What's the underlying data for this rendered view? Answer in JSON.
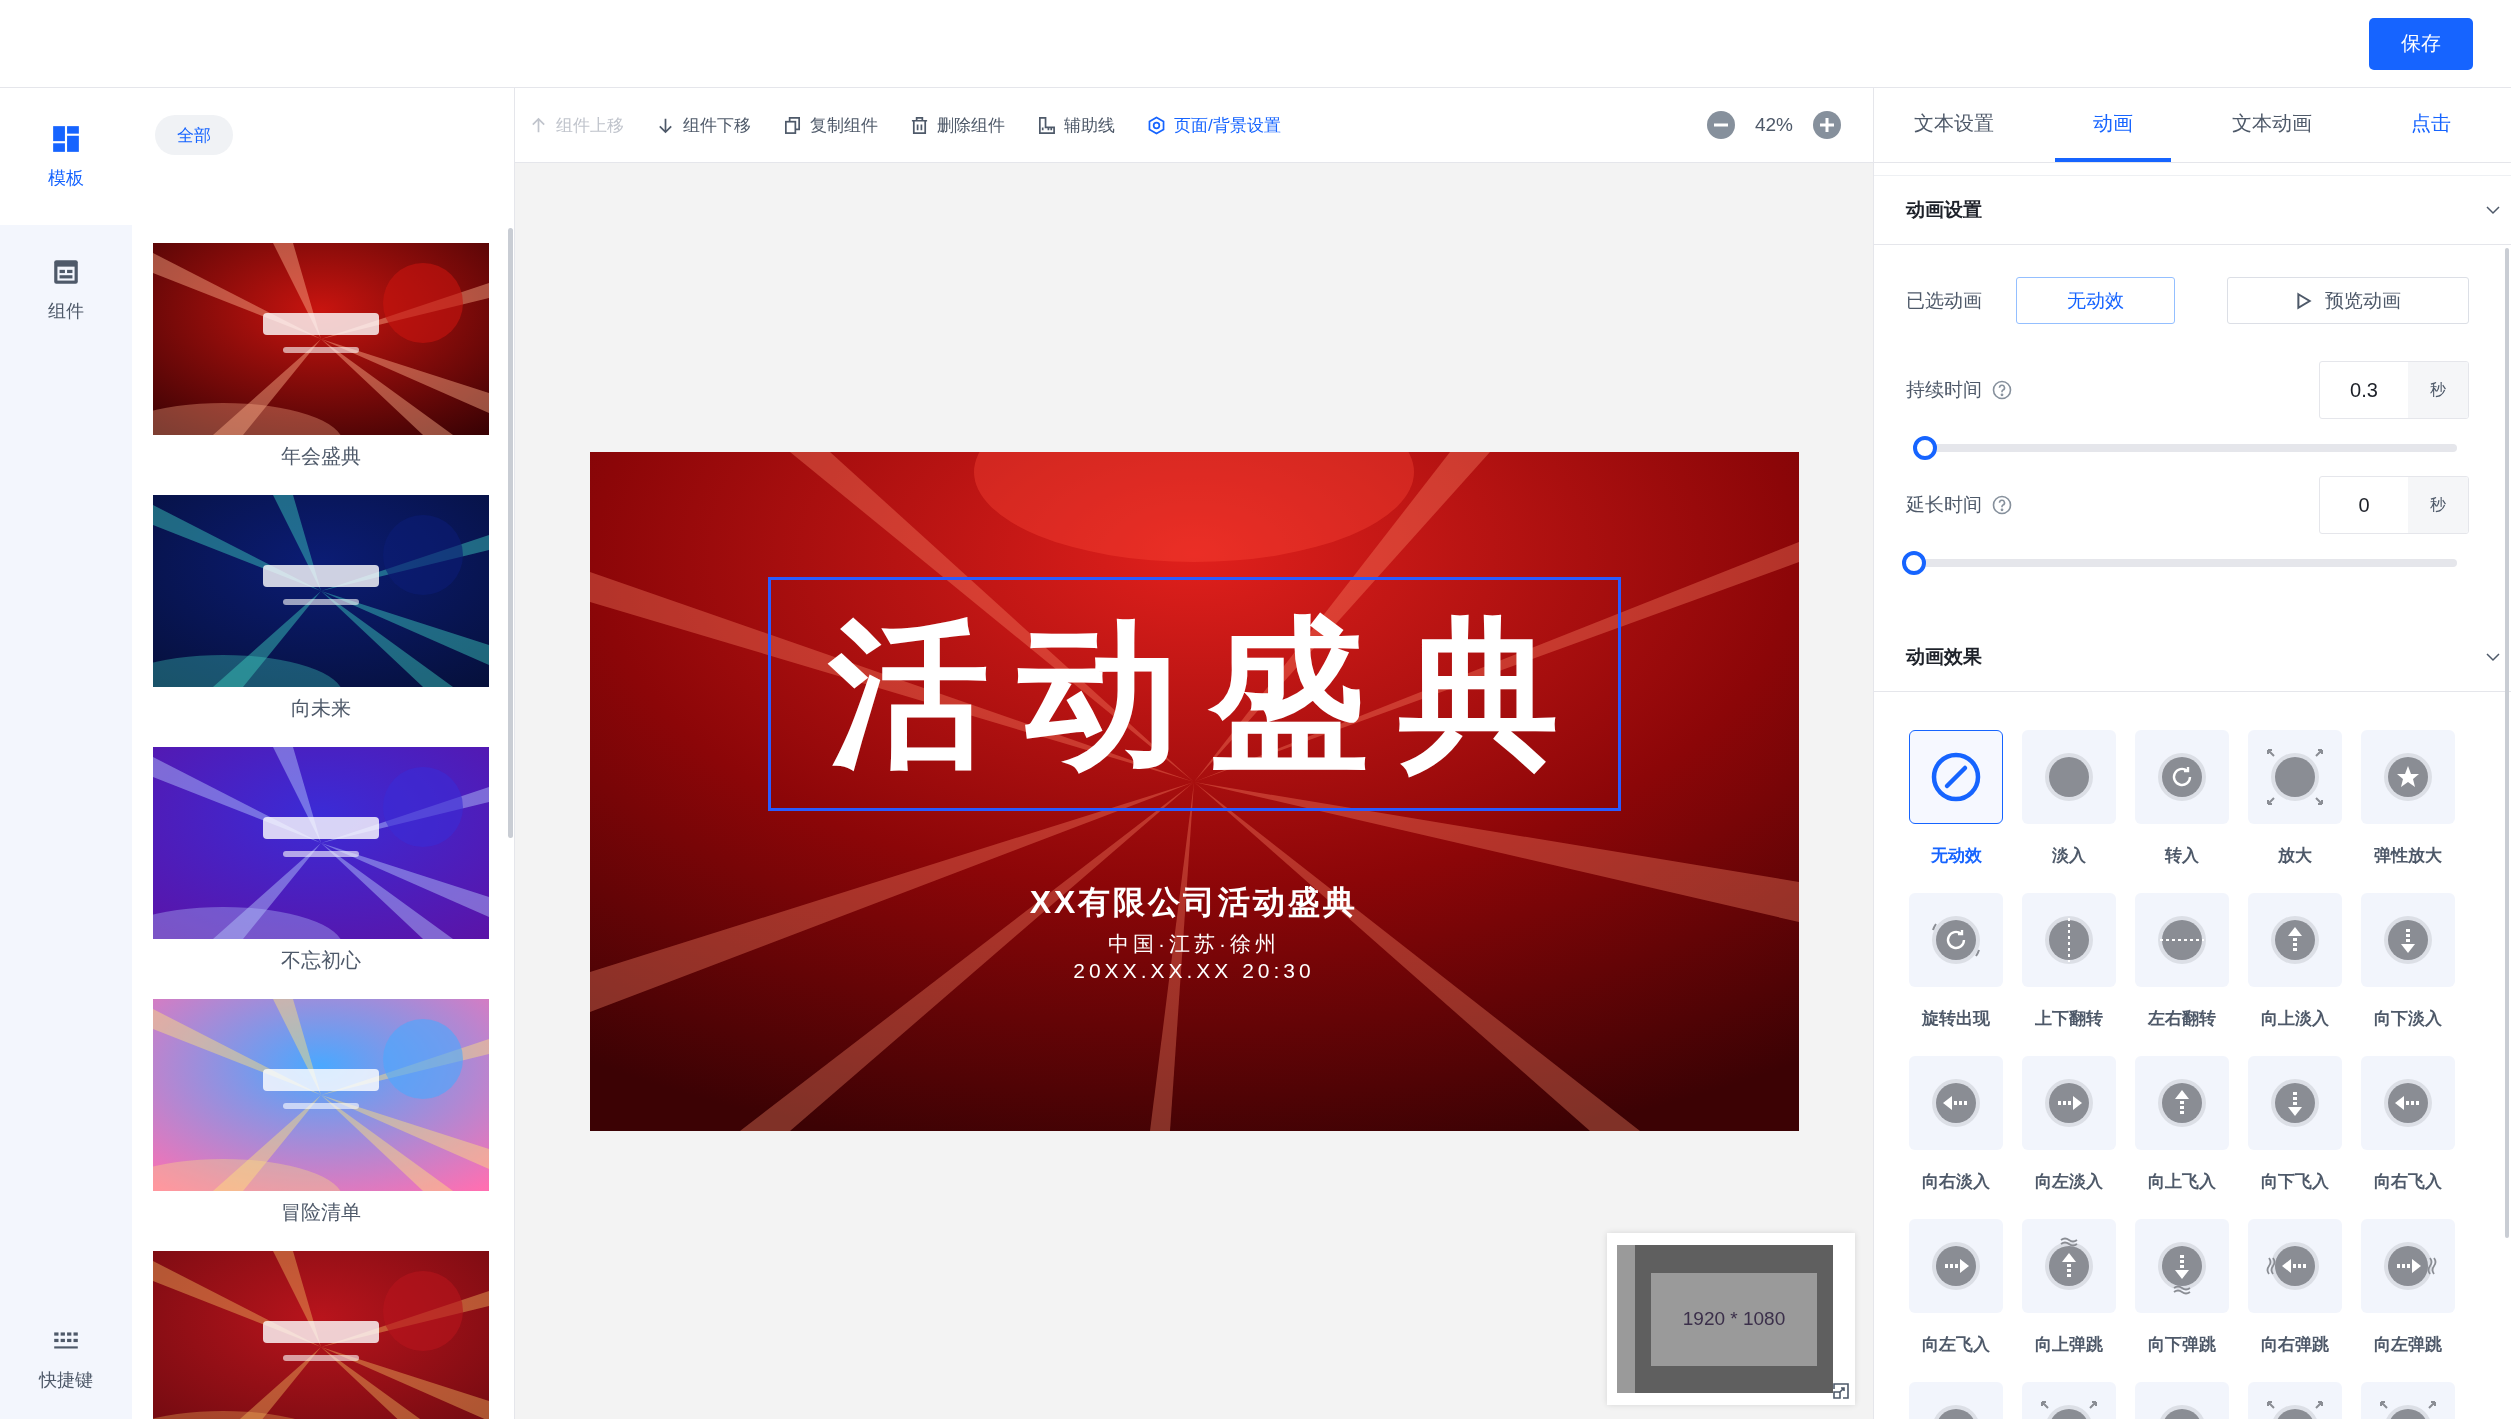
{
  "header": {
    "save_button": "保存"
  },
  "rail": {
    "items": [
      {
        "label": "模板",
        "kind": "template",
        "selected": true
      },
      {
        "label": "组件",
        "kind": "component",
        "selected": false
      }
    ],
    "shortcut": {
      "label": "快捷键"
    }
  },
  "templates": {
    "filter": {
      "label": "全部",
      "selected": true
    },
    "items": [
      {
        "kind": "picture",
        "caption": "年会盛典"
      },
      {
        "kind": "picture",
        "caption": "向未来"
      },
      {
        "kind": "picture",
        "caption": "不忘初心"
      },
      {
        "kind": "picture",
        "caption": "冒险清单"
      },
      {
        "kind": "picture"
      }
    ]
  },
  "toolbar": {
    "items": [
      {
        "label": "组件上移",
        "kind": "up",
        "disabled": true,
        "selected": false
      },
      {
        "label": "组件下移",
        "kind": "down",
        "disabled": false,
        "selected": false
      },
      {
        "label": "复制组件",
        "kind": "copy",
        "disabled": false,
        "selected": false
      },
      {
        "label": "删除组件",
        "kind": "trash",
        "disabled": false,
        "selected": false
      },
      {
        "label": "辅助线",
        "kind": "ruler",
        "disabled": false,
        "selected": false
      },
      {
        "label": "页面/背景设置",
        "kind": "gear",
        "disabled": false,
        "selected": true
      }
    ],
    "zoom": "42%"
  },
  "canvas": {
    "slide": {
      "title": "活动盛典",
      "title_selected": true,
      "subtitle": "XX有限公司活动盛典",
      "location": "中国·江苏·徐州",
      "datetime": "20XX.XX.XX 20:30"
    },
    "minimap": {
      "size": "1920 * 1080"
    }
  },
  "panel": {
    "tabs": [
      {
        "label": "文本设置",
        "selected": false,
        "highlighted": false
      },
      {
        "label": "动画",
        "selected": true,
        "highlighted": false
      },
      {
        "label": "文本动画",
        "selected": false,
        "highlighted": false
      },
      {
        "label": "点击",
        "selected": false,
        "highlighted": true
      }
    ],
    "animation_settings": {
      "title": "动画设置",
      "expanded": true,
      "selected_label": "已选动画",
      "selected_value": "无动效",
      "preview_button": "预览动画",
      "duration": {
        "label": "持续时间",
        "value": "0.3",
        "unit": "秒",
        "level": 0.02
      },
      "delay": {
        "label": "延长时间",
        "value": "0",
        "unit": "秒",
        "level": 0
      }
    },
    "effects": {
      "title": "动画效果",
      "expanded": true,
      "items": [
        {
          "label": "无动效",
          "kind": "none",
          "selected": true
        },
        {
          "label": "淡入",
          "kind": "circle",
          "selected": false
        },
        {
          "label": "转入",
          "kind": "rotate",
          "selected": false
        },
        {
          "label": "放大",
          "kind": "zoom",
          "selected": false
        },
        {
          "label": "弹性放大",
          "kind": "star",
          "selected": false
        },
        {
          "label": "旋转出现",
          "kind": "spin",
          "selected": false
        },
        {
          "label": "上下翻转",
          "kind": "flip-v",
          "selected": false
        },
        {
          "label": "左右翻转",
          "kind": "flip-h",
          "selected": false
        },
        {
          "label": "向上淡入",
          "kind": "arrow-up",
          "selected": false
        },
        {
          "label": "向下淡入",
          "kind": "arrow-down",
          "selected": false
        },
        {
          "label": "向右淡入",
          "kind": "arrow-left",
          "selected": false
        },
        {
          "label": "向左淡入",
          "kind": "arrow-right",
          "selected": false
        },
        {
          "label": "向上飞入",
          "kind": "arrow-up",
          "selected": false
        },
        {
          "label": "向下飞入",
          "kind": "arrow-down",
          "selected": false
        },
        {
          "label": "向右飞入",
          "kind": "arrow-left",
          "selected": false
        },
        {
          "label": "向左飞入",
          "kind": "arrow-right",
          "selected": false
        },
        {
          "label": "向上弹跳",
          "kind": "bounce-up",
          "selected": false
        },
        {
          "label": "向下弹跳",
          "kind": "bounce-down",
          "selected": false
        },
        {
          "label": "向右弹跳",
          "kind": "bounce-left",
          "selected": false
        },
        {
          "label": "向左弹跳",
          "kind": "bounce-right",
          "selected": false
        },
        {
          "kind": "circle",
          "selected": false
        },
        {
          "kind": "zoom",
          "selected": false
        },
        {
          "kind": "circle",
          "selected": false
        },
        {
          "kind": "zoom",
          "selected": false
        },
        {
          "kind": "zoom",
          "selected": false
        }
      ]
    }
  }
}
